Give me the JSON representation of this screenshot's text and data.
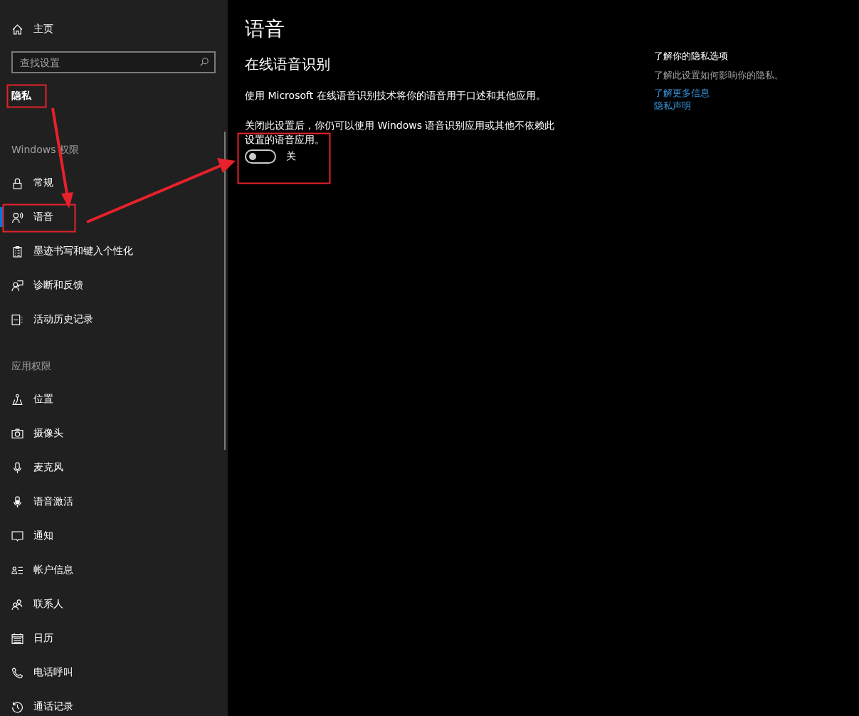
{
  "sidebar": {
    "home": {
      "label": "主页"
    },
    "search": {
      "placeholder": "查找设置"
    },
    "section_title": "隐私",
    "groups": [
      {
        "title": "Windows 权限",
        "items": [
          {
            "label": "常规",
            "selected": false
          },
          {
            "label": "语音",
            "selected": true
          },
          {
            "label": "墨迹书写和键入个性化",
            "selected": false
          },
          {
            "label": "诊断和反馈",
            "selected": false
          },
          {
            "label": "活动历史记录",
            "selected": false
          }
        ]
      },
      {
        "title": "应用权限",
        "items": [
          {
            "label": "位置",
            "selected": false
          },
          {
            "label": "摄像头",
            "selected": false
          },
          {
            "label": "麦克风",
            "selected": false
          },
          {
            "label": "语音激活",
            "selected": false
          },
          {
            "label": "通知",
            "selected": false
          },
          {
            "label": "帐户信息",
            "selected": false
          },
          {
            "label": "联系人",
            "selected": false
          },
          {
            "label": "日历",
            "selected": false
          },
          {
            "label": "电话呼叫",
            "selected": false
          },
          {
            "label": "通话记录",
            "selected": false
          }
        ]
      }
    ]
  },
  "main": {
    "title": "语音",
    "section_heading": "在线语音识别",
    "description": "使用 Microsoft 在线语音识别技术将你的语音用于口述和其他应用。",
    "note": "关闭此设置后，你仍可以使用 Windows 语音识别应用或其他不依赖此设置的语音应用。",
    "toggle": {
      "on": false,
      "label": "关"
    }
  },
  "related": {
    "title": "了解你的隐私选项",
    "text": "了解此设置如何影响你的隐私。",
    "links": [
      "了解更多信息",
      "隐私声明"
    ]
  }
}
